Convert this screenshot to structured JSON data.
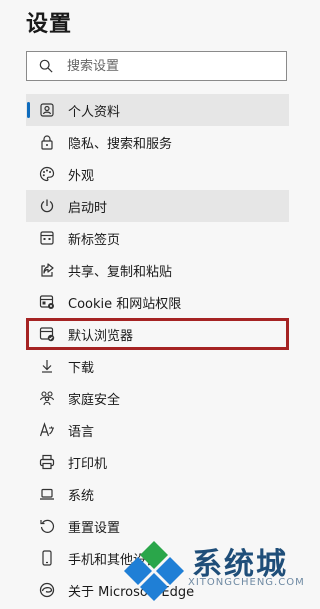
{
  "page_title": "设置",
  "search": {
    "placeholder": "搜索设置"
  },
  "nav": {
    "items": [
      {
        "label": "个人资料",
        "icon": "profile-icon",
        "state": "selected"
      },
      {
        "label": "隐私、搜索和服务",
        "icon": "lock-icon"
      },
      {
        "label": "外观",
        "icon": "palette-icon"
      },
      {
        "label": "启动时",
        "icon": "power-icon",
        "state": "hover"
      },
      {
        "label": "新标签页",
        "icon": "new-tab-icon"
      },
      {
        "label": "共享、复制和粘贴",
        "icon": "share-icon"
      },
      {
        "label": "Cookie 和网站权限",
        "icon": "site-permissions-icon"
      },
      {
        "label": "默认浏览器",
        "icon": "default-browser-icon",
        "state": "highlighted"
      },
      {
        "label": "下载",
        "icon": "download-icon"
      },
      {
        "label": "家庭安全",
        "icon": "family-icon"
      },
      {
        "label": "语言",
        "icon": "language-icon"
      },
      {
        "label": "打印机",
        "icon": "printer-icon"
      },
      {
        "label": "系统",
        "icon": "laptop-icon"
      },
      {
        "label": "重置设置",
        "icon": "reset-icon"
      },
      {
        "label": "手机和其他设备",
        "icon": "phone-icon"
      },
      {
        "label": "关于 Microsoft Edge",
        "icon": "edge-icon"
      }
    ]
  },
  "watermark": {
    "text": "系统城",
    "url": "XITONGCHENG.COM",
    "colors": [
      "#2aa64a",
      "#1f7fd6",
      "#1f4e79"
    ]
  },
  "colors": {
    "accent": "#0f6cbd",
    "highlight_outline": "#a52323",
    "selected_bg": "#e6e6e6"
  }
}
